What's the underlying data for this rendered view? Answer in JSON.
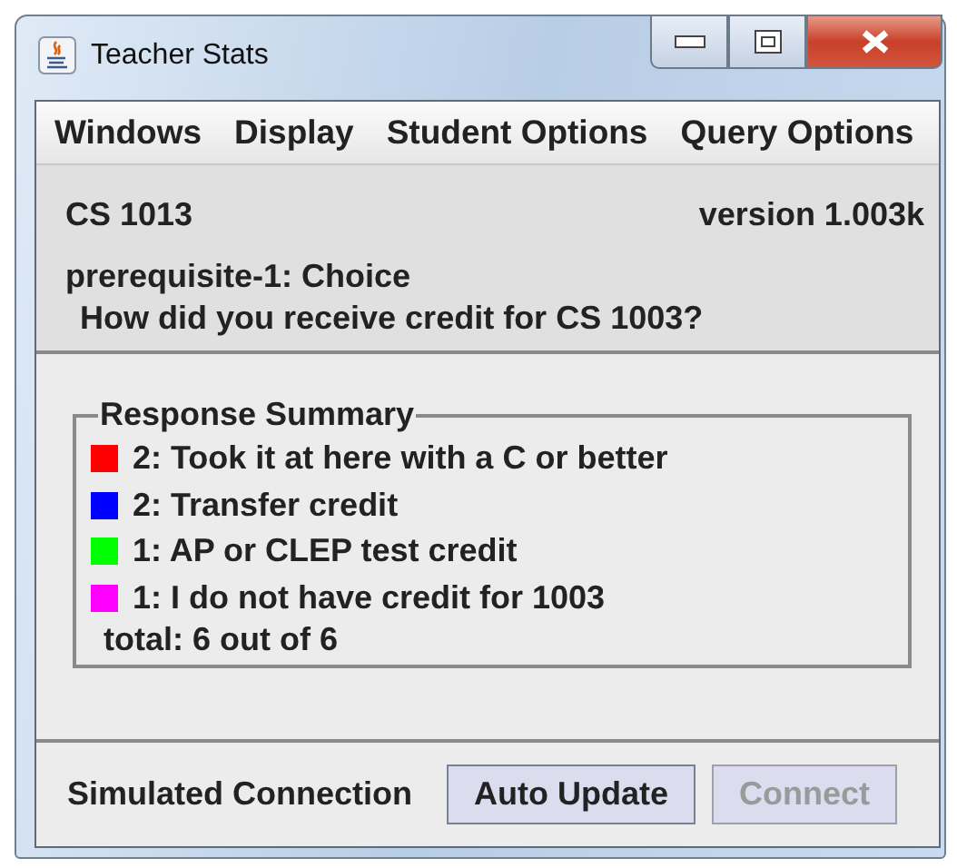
{
  "window": {
    "title": "Teacher Stats"
  },
  "menu": [
    "Windows",
    "Display",
    "Student Options",
    "Query Options"
  ],
  "header": {
    "course": "CS 1013",
    "version": "version 1.003k",
    "question_id": "prerequisite-1: Choice",
    "question": "How did you receive credit for CS 1003?"
  },
  "summary": {
    "title": "Response Summary",
    "responses": [
      {
        "text": "2: Took it at here with a C or better",
        "color": "#ff0000"
      },
      {
        "text": "2: Transfer credit",
        "color": "#0000ff"
      },
      {
        "text": "1: AP or CLEP test credit",
        "color": "#00ff00"
      },
      {
        "text": "1: I do not have credit for 1003",
        "color": "#ff00ff"
      }
    ],
    "total": "total: 6 out of 6"
  },
  "footer": {
    "status": "Simulated Connection",
    "buttons": [
      {
        "label": "Auto Update",
        "disabled": false
      },
      {
        "label": "Connect",
        "disabled": true
      }
    ]
  }
}
